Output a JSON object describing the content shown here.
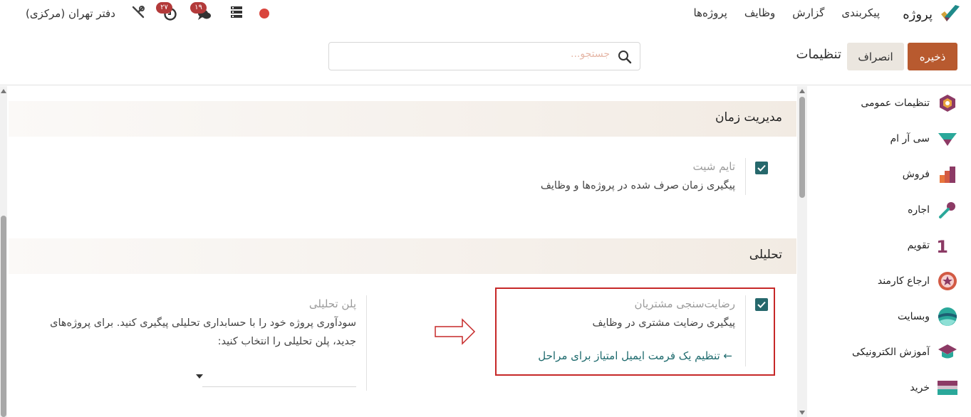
{
  "app": {
    "title": "پروژه",
    "accent": "#b85a2f",
    "teal": "#26686c"
  },
  "menu": [
    "پروژه‌ها",
    "وظایف",
    "گزارش",
    "پیکربندی"
  ],
  "systray": {
    "company": "دفتر تهران (مرکزی)",
    "activity_count": "۲۷",
    "messages_count": "۱۹"
  },
  "control_panel": {
    "save_label": "ذخیره",
    "cancel_label": "انصراف",
    "title": "تنظیمات",
    "search_placeholder": "جستجو..."
  },
  "sidebar": {
    "items": [
      {
        "label": "تنظیمات عمومی",
        "icon": "general-settings-icon"
      },
      {
        "label": "سی آر ام",
        "icon": "crm-icon"
      },
      {
        "label": "فروش",
        "icon": "sales-icon"
      },
      {
        "label": "اجاره",
        "icon": "rental-icon"
      },
      {
        "label": "تقویم",
        "icon": "calendar-icon"
      },
      {
        "label": "ارجاع کارمند",
        "icon": "referral-icon"
      },
      {
        "label": "وبسایت",
        "icon": "website-icon"
      },
      {
        "label": "آموزش الکترونیکی",
        "icon": "elearning-icon"
      },
      {
        "label": "خرید",
        "icon": "purchase-icon"
      }
    ]
  },
  "sections": {
    "time": {
      "title": "مدیریت زمان",
      "timesheet": {
        "title": "تایم شیت",
        "desc": "پیگیری زمان صرف شده در پروژه‌ها و وظایف",
        "checked": true
      }
    },
    "analytics": {
      "title": "تحلیلی",
      "rating": {
        "title": "رضایت‌سنجی مشتریان",
        "desc": "پیگیری رضایت مشتری در وظایف",
        "checked": true,
        "link": "تنظیم یک فرمت ایمیل امتیاز برای مراحل"
      },
      "plan": {
        "title": "پلن تحلیلی",
        "desc": "سودآوری پروژه خود را با حسابداری تحلیلی پیگیری کنید. برای پروژه‌های جدید، پلن تحلیلی را انتخاب کنید:"
      }
    }
  }
}
